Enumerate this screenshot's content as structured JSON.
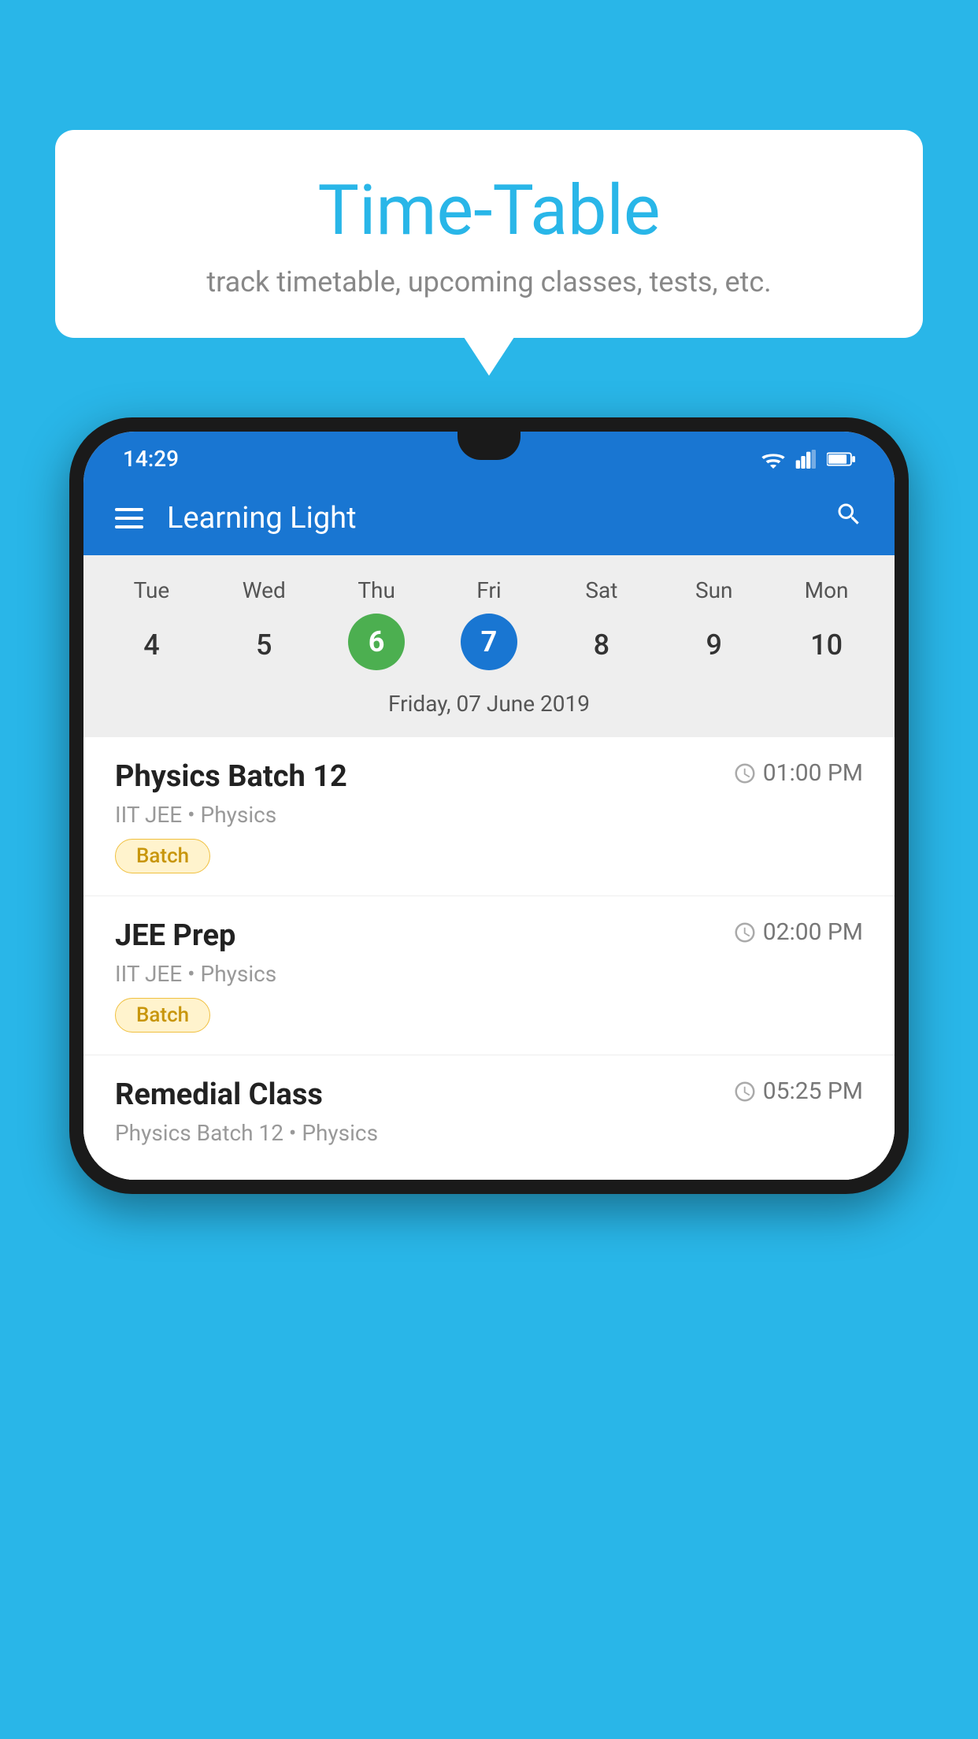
{
  "background_color": "#29B6E8",
  "bubble": {
    "title": "Time-Table",
    "subtitle": "track timetable, upcoming classes, tests, etc."
  },
  "phone": {
    "status_bar": {
      "time": "14:29",
      "icons": [
        "wifi",
        "signal",
        "battery"
      ]
    },
    "app_bar": {
      "title": "Learning Light"
    },
    "calendar": {
      "days": [
        "Tue",
        "Wed",
        "Thu",
        "Fri",
        "Sat",
        "Sun",
        "Mon"
      ],
      "dates": [
        "4",
        "5",
        "6",
        "7",
        "8",
        "9",
        "10"
      ],
      "today_index": 2,
      "selected_index": 3,
      "selected_label": "Friday, 07 June 2019"
    },
    "schedule": [
      {
        "name": "Physics Batch 12",
        "time": "01:00 PM",
        "sub": "IIT JEE • Physics",
        "badge": "Batch"
      },
      {
        "name": "JEE Prep",
        "time": "02:00 PM",
        "sub": "IIT JEE • Physics",
        "badge": "Batch"
      },
      {
        "name": "Remedial Class",
        "time": "05:25 PM",
        "sub": "Physics Batch 12 • Physics",
        "badge": null
      }
    ]
  }
}
